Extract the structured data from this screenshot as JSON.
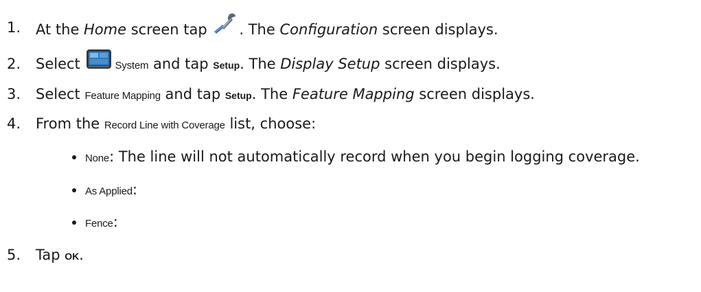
{
  "icons": [
    "wrench-icon",
    "system-icon"
  ],
  "steps": [
    {
      "number": "1.",
      "t1": "At the ",
      "home": "Home",
      "t2": " screen tap ",
      "t3": ". The ",
      "configuration": "Configuration",
      "t4": " screen displays."
    },
    {
      "number": "2.",
      "t1": "Select ",
      "system": "System",
      "t2": " and tap ",
      "setup": "Setup",
      "t3": ". The ",
      "display_setup": "Display Setup",
      "t4": " screen displays."
    },
    {
      "number": "3.",
      "t1": "Select ",
      "feature_mapping": "Feature Mapping",
      "t2": " and tap ",
      "setup": "Setup",
      "t3": ". The ",
      "feature_mapping_screen": "Feature Mapping",
      "t4": " screen displays."
    },
    {
      "number": "4.",
      "t1": "From the ",
      "record_line": "Record Line with Coverage",
      "t2": " list, choose:",
      "options": [
        {
          "label": "None",
          "desc": ": The line will not automatically record when you begin logging coverage."
        },
        {
          "label": "As Applied",
          "desc": ":"
        },
        {
          "label": "Fence",
          "desc": ":"
        }
      ]
    },
    {
      "number": "5.",
      "t1": "Tap ",
      "ok": "OK",
      "t2": "."
    }
  ]
}
